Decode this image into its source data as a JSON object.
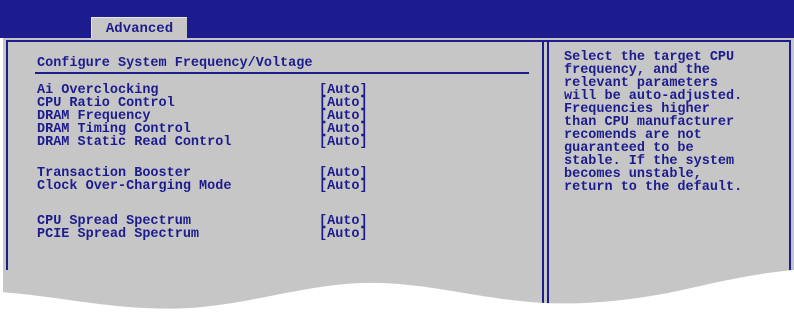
{
  "tabs": [
    {
      "label": "Advanced",
      "active": true
    }
  ],
  "main": {
    "section_title": "Configure System Frequency/Voltage",
    "settings": [
      {
        "name": "Ai Overclocking",
        "value": "[Auto]"
      },
      {
        "name": "CPU Ratio Control",
        "value": "[Auto]"
      },
      {
        "name": "DRAM Frequency",
        "value": "[Auto]"
      },
      {
        "name": "DRAM Timing Control",
        "value": "[Auto]"
      },
      {
        "name": "DRAM Static Read Control",
        "value": "[Auto]"
      },
      {
        "name": "Transaction Booster",
        "value": "[Auto]"
      },
      {
        "name": "Clock Over-Charging Mode",
        "value": "[Auto]"
      },
      {
        "name": "CPU Spread Spectrum",
        "value": "[Auto]"
      },
      {
        "name": "PCIE Spread Spectrum",
        "value": "[Auto]"
      }
    ]
  },
  "help": {
    "lines": [
      "Select the target CPU",
      "frequency, and the",
      "relevant parameters",
      "will be auto-adjusted.",
      "Frequencies higher",
      "than CPU manufacturer",
      "recomends are not",
      "guaranteed to be",
      "stable. If the system",
      "becomes unstable,",
      "return to the default."
    ]
  },
  "colors": {
    "bios_blue": "#1c1c8e",
    "panel_gray": "#c6c6c6",
    "background": "#ffffff"
  }
}
